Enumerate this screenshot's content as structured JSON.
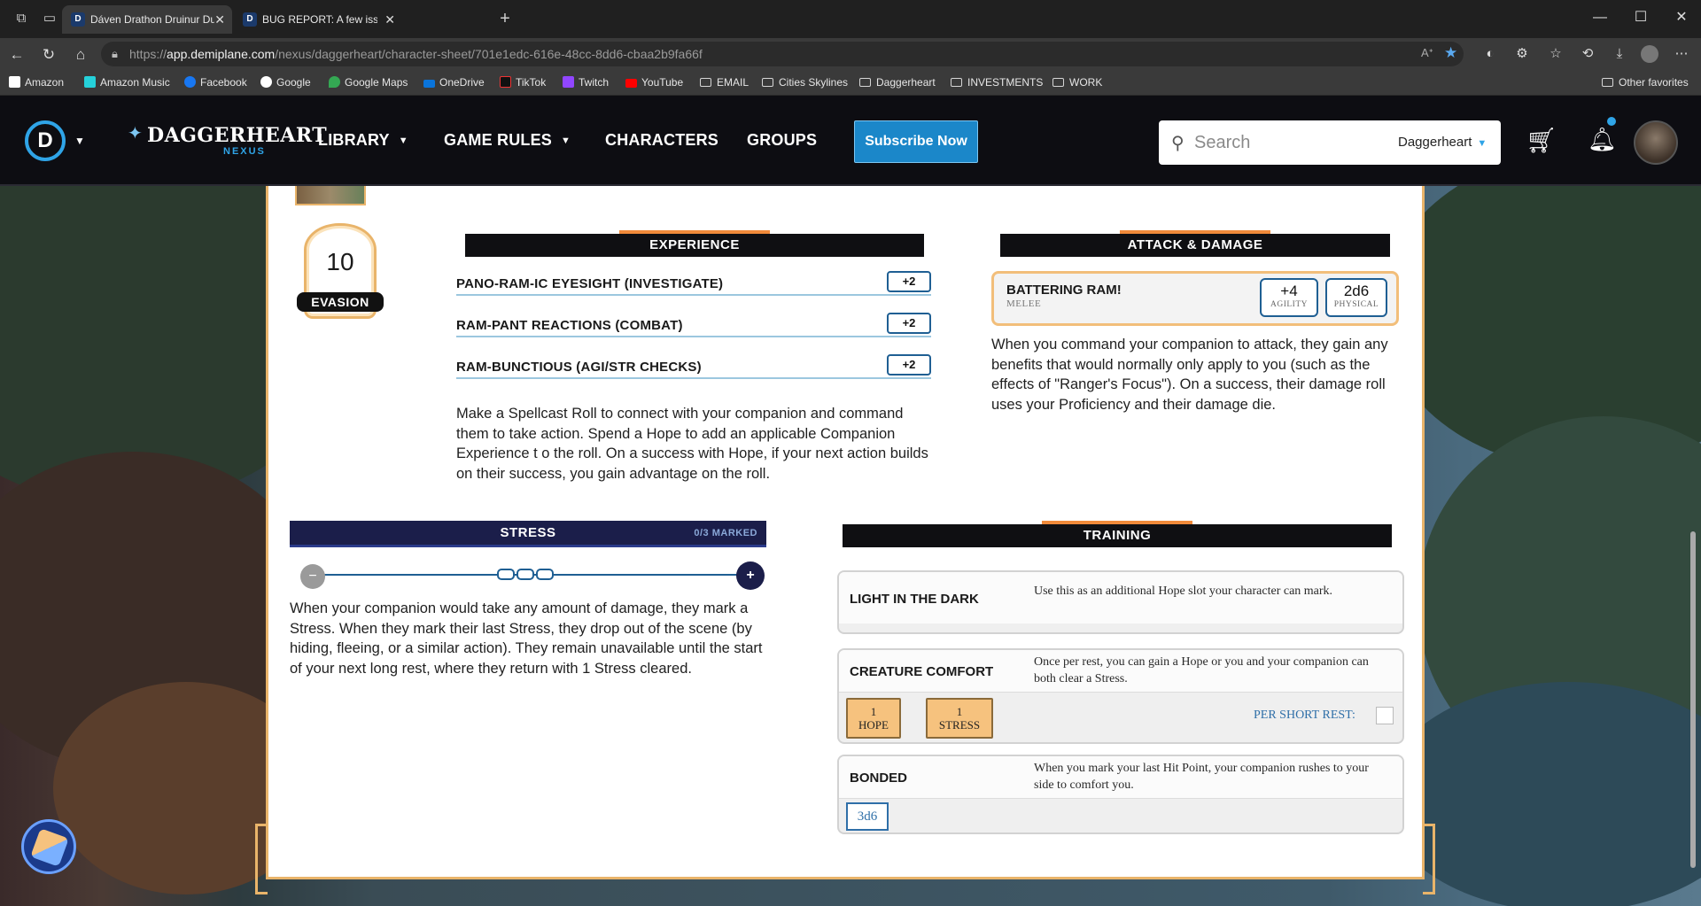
{
  "browser": {
    "tabs": [
      {
        "title": "Dáven Drathon Druinur Duskridg",
        "favicon": "D",
        "active": true
      },
      {
        "title": "BUG REPORT: A few issues that I'v",
        "favicon": "D",
        "active": false
      }
    ],
    "url_prefix": "https://",
    "url_host": "app.demiplane.com",
    "url_path": "/nexus/daggerheart/character-sheet/701e1edc-616e-48cc-8dd6-cbaa2b9fa66f",
    "bookmarks": [
      {
        "label": "Amazon",
        "icon": "amazon-icon"
      },
      {
        "label": "Amazon Music",
        "icon": "amazon-music-icon"
      },
      {
        "label": "Facebook",
        "icon": "facebook-icon"
      },
      {
        "label": "Google",
        "icon": "google-icon"
      },
      {
        "label": "Google Maps",
        "icon": "google-maps-icon"
      },
      {
        "label": "OneDrive",
        "icon": "onedrive-icon"
      },
      {
        "label": "TikTok",
        "icon": "tiktok-icon"
      },
      {
        "label": "Twitch",
        "icon": "twitch-icon"
      },
      {
        "label": "YouTube",
        "icon": "youtube-icon"
      },
      {
        "label": "EMAIL",
        "icon": "folder-icon"
      },
      {
        "label": "Cities Skylines",
        "icon": "folder-icon"
      },
      {
        "label": "Daggerheart",
        "icon": "folder-icon"
      },
      {
        "label": "INVESTMENTS",
        "icon": "folder-icon"
      },
      {
        "label": "WORK",
        "icon": "folder-icon"
      }
    ],
    "other_favorites": "Other favorites"
  },
  "site": {
    "logo_letter": "D",
    "brand": "DAGGERHEART",
    "brand_sub": "NEXUS",
    "nav": {
      "library": "LIBRARY",
      "game_rules": "GAME RULES",
      "characters": "CHARACTERS",
      "groups": "GROUPS"
    },
    "subscribe": "Subscribe Now",
    "search_placeholder": "Search",
    "search_scope": "Daggerheart",
    "accent": "#2fa4e7"
  },
  "sheet": {
    "evasion": {
      "value": "10",
      "label": "EVASION"
    },
    "experience": {
      "header": "EXPERIENCE",
      "items": [
        {
          "name": "PANO-RAM-IC EYESIGHT (INVESTIGATE)",
          "mod": "+2"
        },
        {
          "name": "RAM-PANT REACTIONS (COMBAT)",
          "mod": "+2"
        },
        {
          "name": "RAM-BUNCTIOUS (AGI/STR CHECKS)",
          "mod": "+2"
        }
      ],
      "description": "Make a Spellcast Roll to connect with your companion and command them to take action. Spend a Hope to add an applicable Companion Experience t o the roll. On a success with Hope, if your next action builds on their success, you gain advantage on the roll."
    },
    "attack": {
      "header": "ATTACK & DAMAGE",
      "name": "BATTERING RAM!",
      "range": "MELEE",
      "modifier": "+4",
      "modifier_label": "AGILITY",
      "damage": "2d6",
      "damage_label": "PHYSICAL",
      "description": "When you command your companion to attack, they gain any benefits that would normally only apply to you (such as the effects of \"Ranger's Focus\"). On a success, their damage roll uses your Proficiency and their damage die."
    },
    "stress": {
      "title": "STRESS",
      "count": "0/3 MARKED",
      "marked": 0,
      "slots": 3,
      "minus": "−",
      "plus": "+",
      "description": "When your companion would take any amount of damage, they mark a Stress. When they mark their last Stress, they drop out of the scene (by hiding, fleeing, or a similar action). They remain unavailable until the start of your next long rest, where they return with 1 Stress cleared."
    },
    "training": {
      "header": "TRAINING",
      "items": [
        {
          "name": "LIGHT IN THE DARK",
          "description": "Use this as an additional Hope slot your character can mark."
        },
        {
          "name": "CREATURE COMFORT",
          "description": "Once per rest, you can gain a Hope or you and your companion can both clear a Stress.",
          "cost1_num": "1",
          "cost1_label": "HOPE",
          "cost2_num": "1",
          "cost2_label": "STRESS",
          "per_rest": "PER SHORT REST:"
        },
        {
          "name": "BONDED",
          "description": "When you mark your last Hit Point, your companion rushes to your side to comfort you.",
          "die": "3d6"
        }
      ]
    }
  }
}
